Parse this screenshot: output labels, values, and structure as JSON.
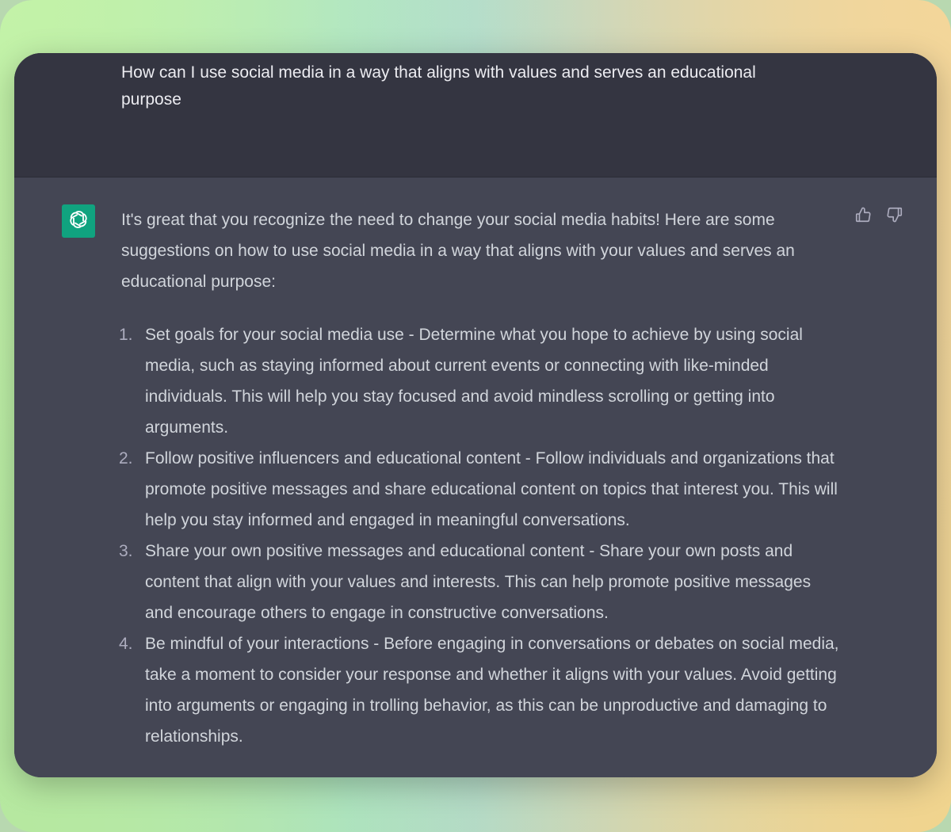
{
  "conversation": {
    "user_message": "How can I use social media in a way that aligns with values and serves an educational purpose",
    "assistant": {
      "avatar_icon": "openai-logo-icon",
      "avatar_color": "#10a37f",
      "intro": "It's great that you recognize the need to change your social media habits! Here are some suggestions on how to use social media in a way that aligns with your values and serves an educational purpose:",
      "items": [
        {
          "number": "1.",
          "text": "Set goals for your social media use - Determine what you hope to achieve by using social media, such as staying informed about current events or connecting with like-minded individuals. This will help you stay focused and avoid mindless scrolling or getting into arguments."
        },
        {
          "number": "2.",
          "text": "Follow positive influencers and educational content - Follow individuals and organizations that promote positive messages and share educational content on topics that interest you. This will help you stay informed and engaged in meaningful conversations."
        },
        {
          "number": "3.",
          "text": "Share your own positive messages and educational content - Share your own posts and content that align with your values and interests. This can help promote positive messages and encourage others to engage in constructive conversations."
        },
        {
          "number": "4.",
          "text": "Be mindful of your interactions - Before engaging in conversations or debates on social media, take a moment to consider your response and whether it aligns with your values. Avoid getting into arguments or engaging in trolling behavior, as this can be unproductive and damaging to relationships."
        }
      ],
      "feedback_icons": [
        "thumbs-up-icon",
        "thumbs-down-icon"
      ]
    }
  },
  "colors": {
    "user_bg": "#343541",
    "assistant_bg": "#444654",
    "user_text": "#ececf1",
    "assistant_text": "#d1d5db",
    "accent": "#10a37f"
  }
}
